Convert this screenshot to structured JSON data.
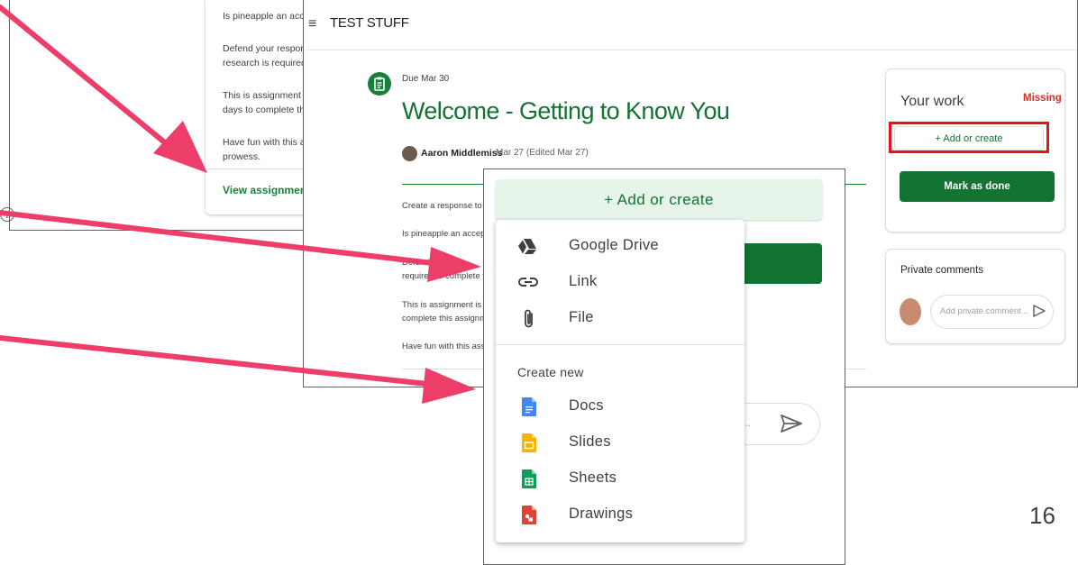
{
  "back_screen": {
    "body_lines": [
      "Is pineapple an acce",
      "Defend your respons",
      "research is required",
      "This is assignment i",
      "days to complete th",
      "Have fun with this a",
      "prowess."
    ],
    "view_link": "View assignment",
    "help_icon": "?"
  },
  "main_screen": {
    "menu_icon": "≡",
    "class_title": "TEST STUFF",
    "due": "Due Mar 30",
    "title": "Welcome - Getting to Know You",
    "author": "Aaron Middlemiss",
    "date": "Mar 27 (Edited Mar 27)",
    "body_lines": [
      "Create a response to th",
      "Is pineapple an accepta",
      "Defend y",
      "required to complete th",
      "This is assignment is be",
      "complete this assignme",
      "Have fun with this assig"
    ],
    "side_fragment": "s"
  },
  "your_work": {
    "title": "Your work",
    "status": "Missing",
    "add_button": "+  Add or create",
    "mark_done": "Mark as done"
  },
  "private_comments": {
    "title": "Private comments",
    "placeholder": "Add private comment..."
  },
  "front_screen": {
    "add_button": "+  Add or create",
    "comment_ellipsis": "..."
  },
  "dropdown": {
    "attach_items": [
      {
        "label": "Google Drive",
        "icon": "google-drive-icon"
      },
      {
        "label": "Link",
        "icon": "link-icon"
      },
      {
        "label": "File",
        "icon": "paperclip-icon"
      }
    ],
    "create_new_label": "Create new",
    "create_items": [
      {
        "label": "Docs",
        "icon": "docs-icon",
        "color": "#4285f4"
      },
      {
        "label": "Slides",
        "icon": "slides-icon",
        "color": "#f4b400"
      },
      {
        "label": "Sheets",
        "icon": "sheets-icon",
        "color": "#0f9d58"
      },
      {
        "label": "Drawings",
        "icon": "drawings-icon",
        "color": "#db4437"
      }
    ]
  },
  "page_number": "16",
  "colors": {
    "accent_green": "#137333",
    "light_green": "#e6f4ea",
    "missing_red": "#d93025",
    "highlight_red": "#e8121b",
    "arrow_pink": "#ec3e68"
  }
}
